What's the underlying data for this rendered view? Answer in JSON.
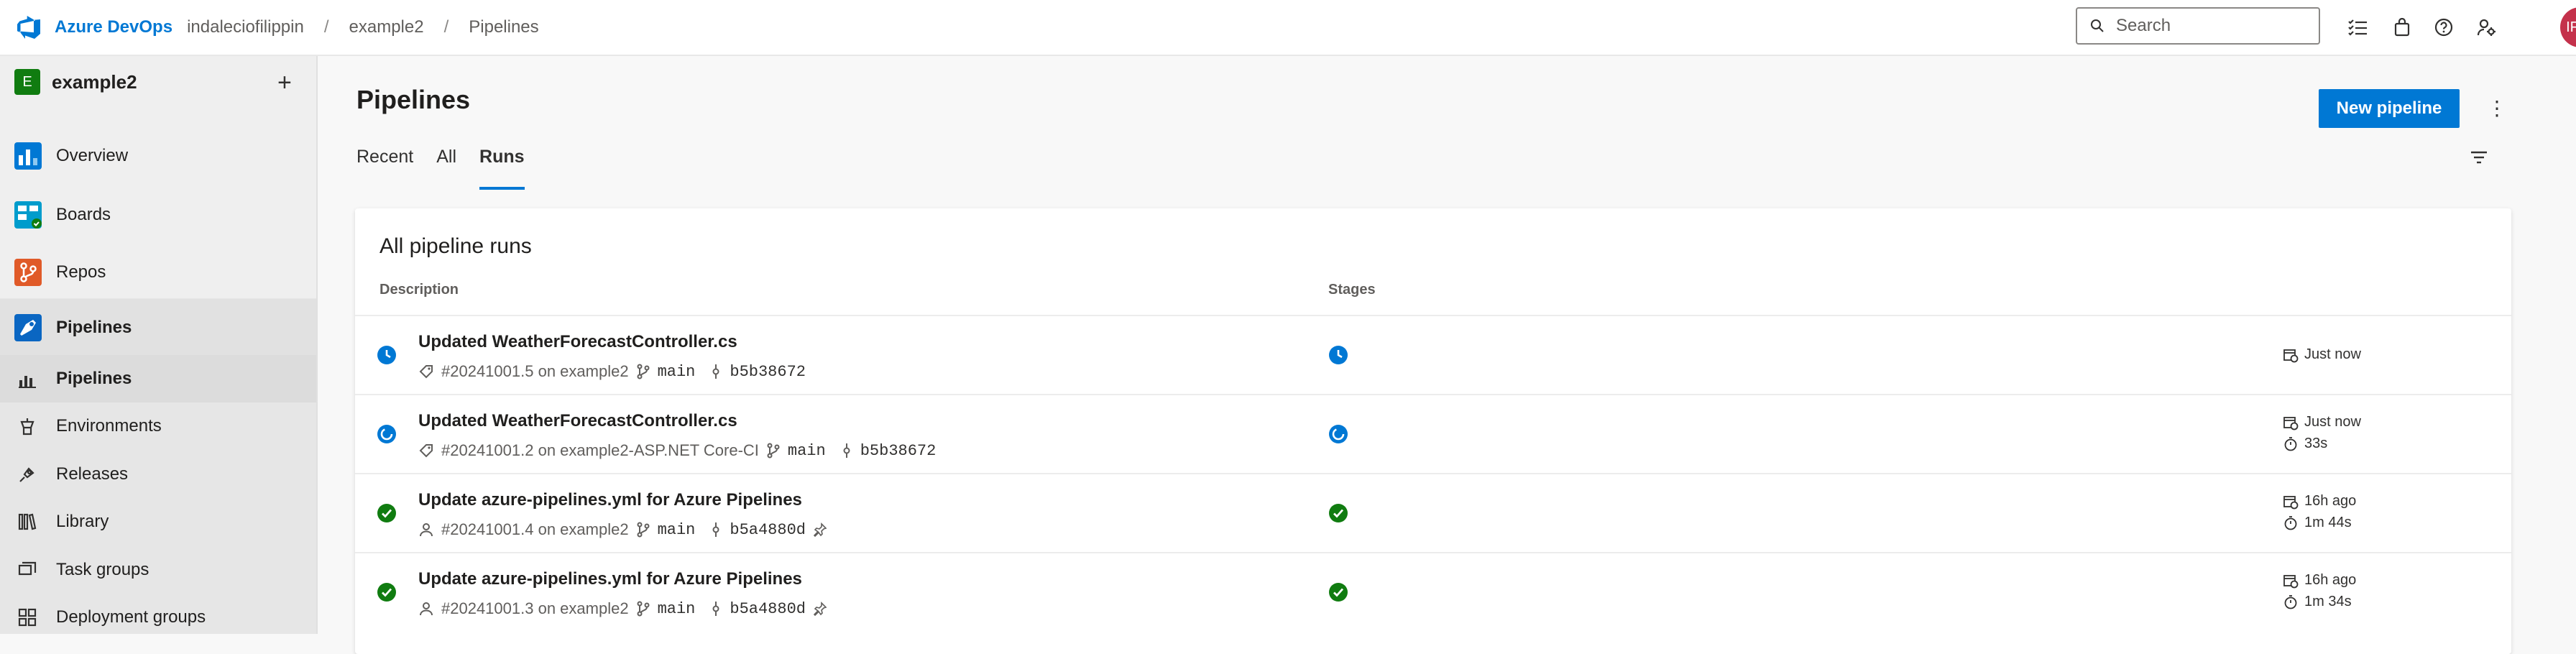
{
  "header": {
    "brand": "Azure DevOps",
    "breadcrumbs": [
      "indaleciofilippin",
      "example2",
      "Pipelines"
    ],
    "search_placeholder": "Search",
    "avatar_initials": "IF",
    "icons": [
      "task-list-icon",
      "shopping-bag-icon",
      "help-icon",
      "user-settings-icon"
    ]
  },
  "sidebar": {
    "project_initial": "E",
    "project_name": "example2",
    "items": [
      {
        "label": "Overview",
        "icon": "overview-icon",
        "color": "#0078d4"
      },
      {
        "label": "Boards",
        "icon": "boards-icon",
        "color": "#009ccc"
      },
      {
        "label": "Repos",
        "icon": "repos-icon",
        "color": "#e05a28"
      },
      {
        "label": "Pipelines",
        "icon": "pipelines-icon",
        "color": "#0a66c2"
      }
    ],
    "subitems": [
      {
        "label": "Pipelines",
        "icon": "pipelines-sub-icon"
      },
      {
        "label": "Environments",
        "icon": "environments-icon"
      },
      {
        "label": "Releases",
        "icon": "releases-icon"
      },
      {
        "label": "Library",
        "icon": "library-icon"
      },
      {
        "label": "Task groups",
        "icon": "task-groups-icon"
      },
      {
        "label": "Deployment groups",
        "icon": "deployment-groups-icon"
      }
    ]
  },
  "main": {
    "title": "Pipelines",
    "new_button": "New pipeline",
    "tabs": [
      {
        "label": "Recent"
      },
      {
        "label": "All"
      },
      {
        "label": "Runs"
      }
    ],
    "active_tab": "Runs"
  },
  "runs": {
    "title": "All pipeline runs",
    "columns": [
      "Description",
      "Stages"
    ],
    "rows": [
      {
        "title": "Updated WeatherForecastController.cs",
        "id": "#20241001.5 on example2",
        "branch": "main",
        "commit": "b5b38672",
        "status": "queued",
        "trigger": "tag",
        "time": "Just now",
        "duration": ""
      },
      {
        "title": "Updated WeatherForecastController.cs",
        "id": "#20241001.2 on example2-ASP.NET Core-CI",
        "branch": "main",
        "commit": "b5b38672",
        "status": "running",
        "trigger": "tag",
        "time": "Just now",
        "duration": "33s"
      },
      {
        "title": "Update azure-pipelines.yml for Azure Pipelines",
        "id": "#20241001.4 on example2",
        "branch": "main",
        "commit": "b5a4880d",
        "status": "succeeded",
        "trigger": "user",
        "time": "16h ago",
        "duration": "1m 44s"
      },
      {
        "title": "Update azure-pipelines.yml for Azure Pipelines",
        "id": "#20241001.3 on example2",
        "branch": "main",
        "commit": "b5a4880d",
        "status": "succeeded",
        "trigger": "user",
        "time": "16h ago",
        "duration": "1m 34s"
      }
    ]
  },
  "colors": {
    "accent": "#0078d4",
    "success": "#107c10",
    "running": "#0078d4"
  }
}
